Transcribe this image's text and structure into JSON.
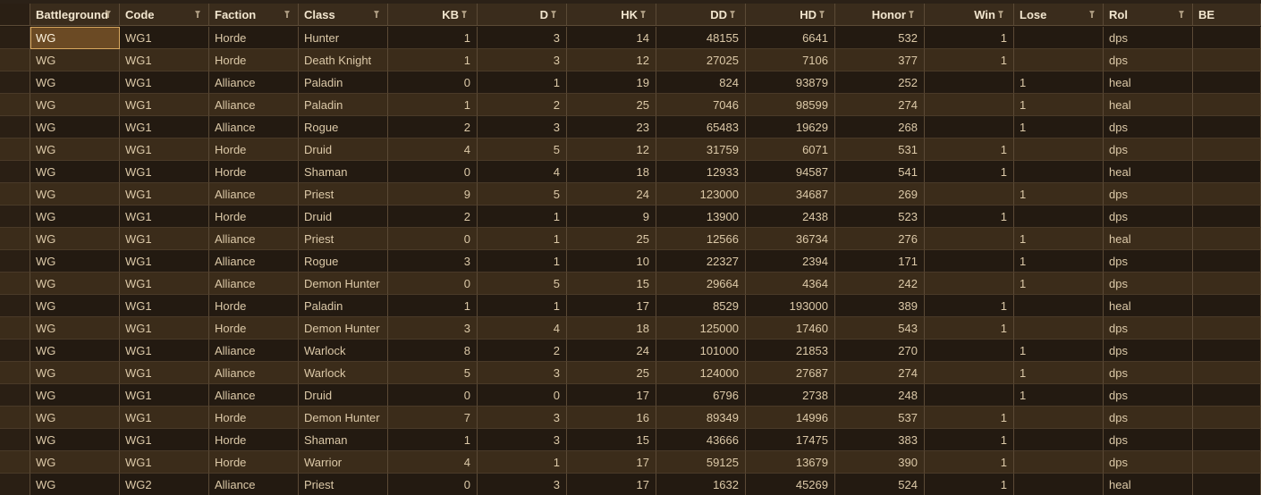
{
  "columns": [
    {
      "label": "Battleground",
      "filter": true
    },
    {
      "label": "Code",
      "filter": true
    },
    {
      "label": "Faction",
      "filter": true
    },
    {
      "label": "Class",
      "filter": true
    },
    {
      "label": "KB",
      "filter": true
    },
    {
      "label": "D",
      "filter": true
    },
    {
      "label": "HK",
      "filter": true
    },
    {
      "label": "DD",
      "filter": true
    },
    {
      "label": "HD",
      "filter": true
    },
    {
      "label": "Honor",
      "filter": true
    },
    {
      "label": "Win",
      "filter": true
    },
    {
      "label": "Lose",
      "filter": true
    },
    {
      "label": "Rol",
      "filter": true
    },
    {
      "label": "BE",
      "filter": false
    }
  ],
  "rows": [
    [
      "WG",
      "WG1",
      "Horde",
      "Hunter",
      "1",
      "3",
      "14",
      "48155",
      "6641",
      "532",
      "1",
      "",
      "dps",
      ""
    ],
    [
      "WG",
      "WG1",
      "Horde",
      "Death Knight",
      "1",
      "3",
      "12",
      "27025",
      "7106",
      "377",
      "1",
      "",
      "dps",
      ""
    ],
    [
      "WG",
      "WG1",
      "Alliance",
      "Paladin",
      "0",
      "1",
      "19",
      "824",
      "93879",
      "252",
      "",
      "1",
      "heal",
      ""
    ],
    [
      "WG",
      "WG1",
      "Alliance",
      "Paladin",
      "1",
      "2",
      "25",
      "7046",
      "98599",
      "274",
      "",
      "1",
      "heal",
      ""
    ],
    [
      "WG",
      "WG1",
      "Alliance",
      "Rogue",
      "2",
      "3",
      "23",
      "65483",
      "19629",
      "268",
      "",
      "1",
      "dps",
      ""
    ],
    [
      "WG",
      "WG1",
      "Horde",
      "Druid",
      "4",
      "5",
      "12",
      "31759",
      "6071",
      "531",
      "1",
      "",
      "dps",
      ""
    ],
    [
      "WG",
      "WG1",
      "Horde",
      "Shaman",
      "0",
      "4",
      "18",
      "12933",
      "94587",
      "541",
      "1",
      "",
      "heal",
      ""
    ],
    [
      "WG",
      "WG1",
      "Alliance",
      "Priest",
      "9",
      "5",
      "24",
      "123000",
      "34687",
      "269",
      "",
      "1",
      "dps",
      ""
    ],
    [
      "WG",
      "WG1",
      "Horde",
      "Druid",
      "2",
      "1",
      "9",
      "13900",
      "2438",
      "523",
      "1",
      "",
      "dps",
      ""
    ],
    [
      "WG",
      "WG1",
      "Alliance",
      "Priest",
      "0",
      "1",
      "25",
      "12566",
      "36734",
      "276",
      "",
      "1",
      "heal",
      ""
    ],
    [
      "WG",
      "WG1",
      "Alliance",
      "Rogue",
      "3",
      "1",
      "10",
      "22327",
      "2394",
      "171",
      "",
      "1",
      "dps",
      ""
    ],
    [
      "WG",
      "WG1",
      "Alliance",
      "Demon Hunter",
      "0",
      "5",
      "15",
      "29664",
      "4364",
      "242",
      "",
      "1",
      "dps",
      ""
    ],
    [
      "WG",
      "WG1",
      "Horde",
      "Paladin",
      "1",
      "1",
      "17",
      "8529",
      "193000",
      "389",
      "1",
      "",
      "heal",
      ""
    ],
    [
      "WG",
      "WG1",
      "Horde",
      "Demon Hunter",
      "3",
      "4",
      "18",
      "125000",
      "17460",
      "543",
      "1",
      "",
      "dps",
      ""
    ],
    [
      "WG",
      "WG1",
      "Alliance",
      "Warlock",
      "8",
      "2",
      "24",
      "101000",
      "21853",
      "270",
      "",
      "1",
      "dps",
      ""
    ],
    [
      "WG",
      "WG1",
      "Alliance",
      "Warlock",
      "5",
      "3",
      "25",
      "124000",
      "27687",
      "274",
      "",
      "1",
      "dps",
      ""
    ],
    [
      "WG",
      "WG1",
      "Alliance",
      "Druid",
      "0",
      "0",
      "17",
      "6796",
      "2738",
      "248",
      "",
      "1",
      "dps",
      ""
    ],
    [
      "WG",
      "WG1",
      "Horde",
      "Demon Hunter",
      "7",
      "3",
      "16",
      "89349",
      "14996",
      "537",
      "1",
      "",
      "dps",
      ""
    ],
    [
      "WG",
      "WG1",
      "Horde",
      "Shaman",
      "1",
      "3",
      "15",
      "43666",
      "17475",
      "383",
      "1",
      "",
      "dps",
      ""
    ],
    [
      "WG",
      "WG1",
      "Horde",
      "Warrior",
      "4",
      "1",
      "17",
      "59125",
      "13679",
      "390",
      "1",
      "",
      "dps",
      ""
    ],
    [
      "WG",
      "WG2",
      "Alliance",
      "Priest",
      "0",
      "3",
      "17",
      "1632",
      "45269",
      "524",
      "1",
      "",
      "heal",
      ""
    ]
  ],
  "selected_cell": {
    "row": 0,
    "column": 0
  }
}
